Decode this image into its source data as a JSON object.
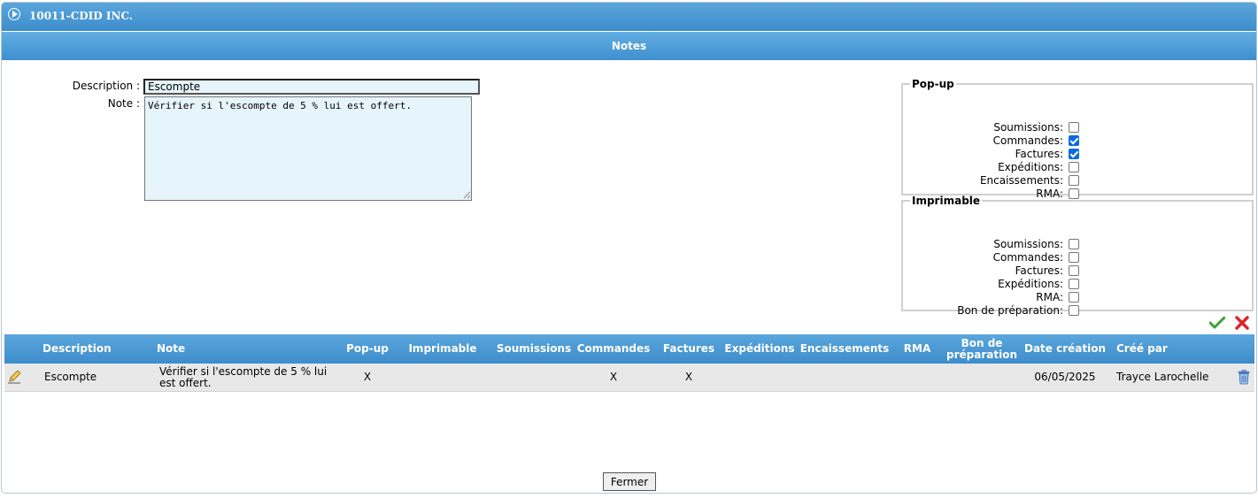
{
  "window": {
    "title": "10011-CDID INC.",
    "subtitle": "Notes"
  },
  "form": {
    "description_label": "Description :",
    "description_value": "Escompte",
    "note_label": "Note :",
    "note_value": "Vérifier si l'escompte de 5 % lui est offert."
  },
  "popup": {
    "legend": "Pop-up",
    "items": [
      {
        "label": "Soumissions:",
        "checked": false
      },
      {
        "label": "Commandes:",
        "checked": true
      },
      {
        "label": "Factures:",
        "checked": true
      },
      {
        "label": "Expéditions:",
        "checked": false
      },
      {
        "label": "Encaissements:",
        "checked": false
      },
      {
        "label": "RMA:",
        "checked": false
      }
    ]
  },
  "printable": {
    "legend": "Imprimable",
    "items": [
      {
        "label": "Soumissions:",
        "checked": false
      },
      {
        "label": "Commandes:",
        "checked": false
      },
      {
        "label": "Factures:",
        "checked": false
      },
      {
        "label": "Expéditions:",
        "checked": false
      },
      {
        "label": "RMA:",
        "checked": false
      },
      {
        "label": "Bon de préparation:",
        "checked": false
      }
    ]
  },
  "table": {
    "headers": [
      "Description",
      "Note",
      "Pop-up",
      "Imprimable",
      "Soumissions",
      "Commandes",
      "Factures",
      "Expéditions",
      "Encaissements",
      "RMA",
      "Bon de préparation",
      "Date création",
      "Créé par"
    ],
    "rows": [
      {
        "description": "Escompte",
        "note": "Vérifier si l'escompte de 5 % lui est offert.",
        "popup": "X",
        "imprimable": "",
        "soumissions": "",
        "commandes": "X",
        "factures": "X",
        "expeditions": "",
        "encaissements": "",
        "rma": "",
        "bon_preparation": "",
        "date_creation": "06/05/2025",
        "cree_par": "Trayce Larochelle"
      }
    ]
  },
  "footer": {
    "close_label": "Fermer"
  },
  "colors": {
    "header_blue": "#3e8dcc",
    "checkbox_blue": "#0b6be0",
    "ok_green": "#3aa335",
    "cancel_red": "#d9262b"
  }
}
